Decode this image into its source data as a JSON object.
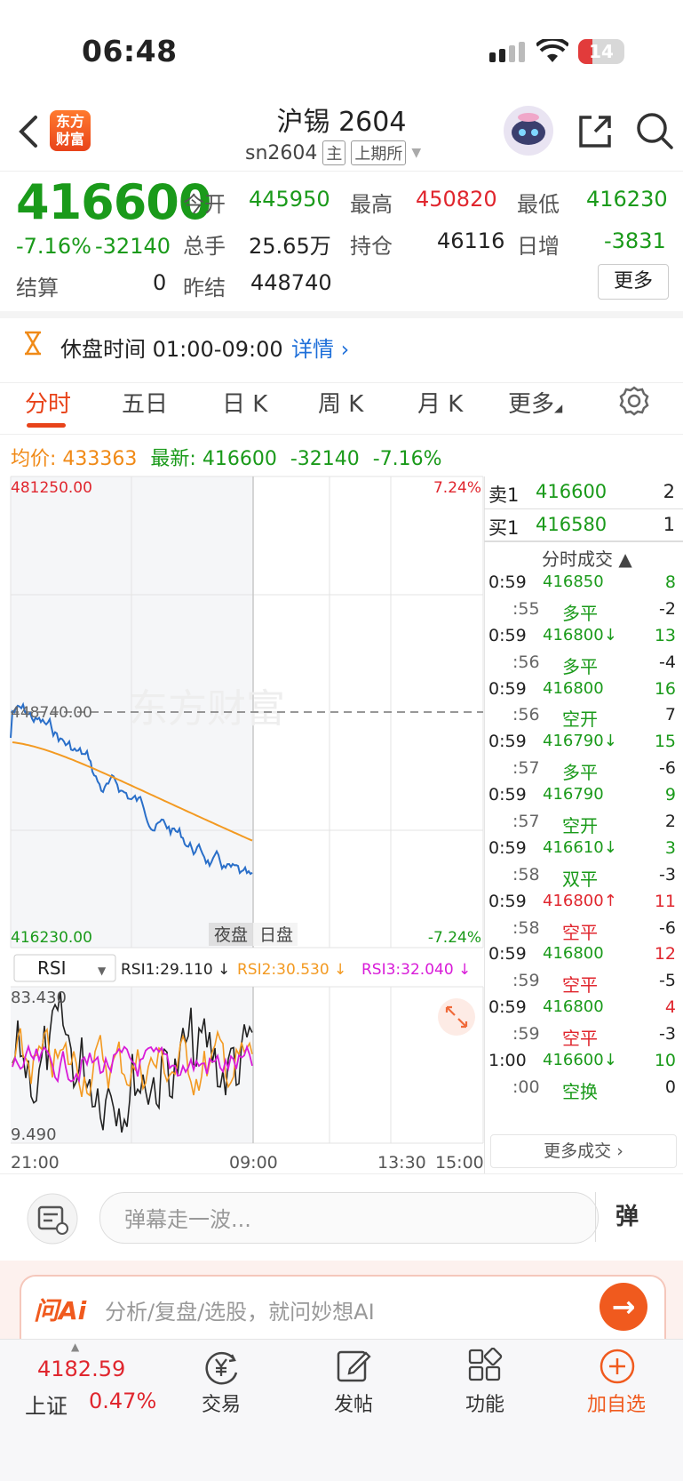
{
  "status": {
    "time": "06:48",
    "battery": "14"
  },
  "header": {
    "title": "沪锡 2604",
    "code": "sn2604",
    "tag_main": "主",
    "tag_exchange": "上期所",
    "logo": "东方\n财富"
  },
  "quote": {
    "price": "416600",
    "change_pct": "-7.16%",
    "change": "-32140",
    "open_label": "今开",
    "open": "445950",
    "high_label": "最高",
    "high": "450820",
    "low_label": "最低",
    "low": "416230",
    "volume_label": "总手",
    "volume": "25.65万",
    "oi_label": "持仓",
    "oi": "46116",
    "daily_inc_label": "日增",
    "daily_inc": "-3831",
    "settle_label": "结算",
    "settle": "0",
    "prev_settle_label": "昨结",
    "prev_settle": "448740",
    "more": "更多"
  },
  "notice": {
    "text": "休盘时间 01:00-09:00",
    "detail": "详情"
  },
  "tabs": [
    "分时",
    "五日",
    "日 K",
    "周 K",
    "月 K",
    "更多"
  ],
  "avg": {
    "avg_label": "均价:",
    "avg": "433363",
    "last_label": "最新:",
    "last": "416600",
    "chg": "-32140",
    "pct": "-7.16%"
  },
  "chart": {
    "y_top": "481250.00",
    "y_mid": "448740.00",
    "y_bottom": "416230.00",
    "pct_top": "7.24%",
    "pct_bottom": "-7.24%",
    "night_label": "夜盘",
    "day_label": "日盘",
    "watermark": "东方财富",
    "times": [
      "21:00",
      "09:00",
      "13:30",
      "15:00"
    ],
    "rsi": {
      "selector": "RSI",
      "rsi1": "RSI1:29.110 ↓",
      "rsi2": "RSI2:30.530 ↓",
      "rsi3": "RSI3:32.040 ↓",
      "max": "83.430",
      "min": "9.490"
    }
  },
  "orderbook": {
    "sell_label": "卖1",
    "sell_price": "416600",
    "sell_qty": "2",
    "buy_label": "买1",
    "buy_price": "416580",
    "buy_qty": "1",
    "ticks_title": "分时成交 ▲",
    "ticks": [
      [
        "0:59",
        "416850",
        "8",
        "g",
        "g"
      ],
      [
        ":55",
        "多平",
        "-2",
        "g",
        "d"
      ],
      [
        "0:59",
        "416800↓",
        "13",
        "g",
        "g"
      ],
      [
        ":56",
        "多平",
        "-4",
        "g",
        "d"
      ],
      [
        "0:59",
        "416800",
        "16",
        "g",
        "g"
      ],
      [
        ":56",
        "空开",
        "7",
        "g",
        "d"
      ],
      [
        "0:59",
        "416790↓",
        "15",
        "g",
        "g"
      ],
      [
        ":57",
        "多平",
        "-6",
        "g",
        "d"
      ],
      [
        "0:59",
        "416790",
        "9",
        "g",
        "g"
      ],
      [
        ":57",
        "空开",
        "2",
        "g",
        "d"
      ],
      [
        "0:59",
        "416610↓",
        "3",
        "g",
        "g"
      ],
      [
        ":58",
        "双平",
        "-3",
        "g",
        "d"
      ],
      [
        "0:59",
        "416800↑",
        "11",
        "r",
        "r"
      ],
      [
        ":58",
        "空平",
        "-6",
        "r",
        "d"
      ],
      [
        "0:59",
        "416800",
        "12",
        "g",
        "r"
      ],
      [
        ":59",
        "空平",
        "-5",
        "r",
        "d"
      ],
      [
        "0:59",
        "416800",
        "4",
        "g",
        "r"
      ],
      [
        ":59",
        "空平",
        "-3",
        "r",
        "d"
      ],
      [
        "1:00",
        "416600↓",
        "10",
        "g",
        "g"
      ],
      [
        ":00",
        "空换",
        "0",
        "g",
        "d"
      ]
    ],
    "more_ticks": "更多成交"
  },
  "danmu": {
    "placeholder": "弹幕走一波...",
    "send": "弹"
  },
  "ai": {
    "brand": "问Ai",
    "placeholder": "分析/复盘/选股，就问妙想AI"
  },
  "tabbar": {
    "index_value": "4182.59",
    "index_name": "上证",
    "index_pct": "0.47%",
    "trade": "交易",
    "post": "发帖",
    "func": "功能",
    "add": "加自选"
  }
}
